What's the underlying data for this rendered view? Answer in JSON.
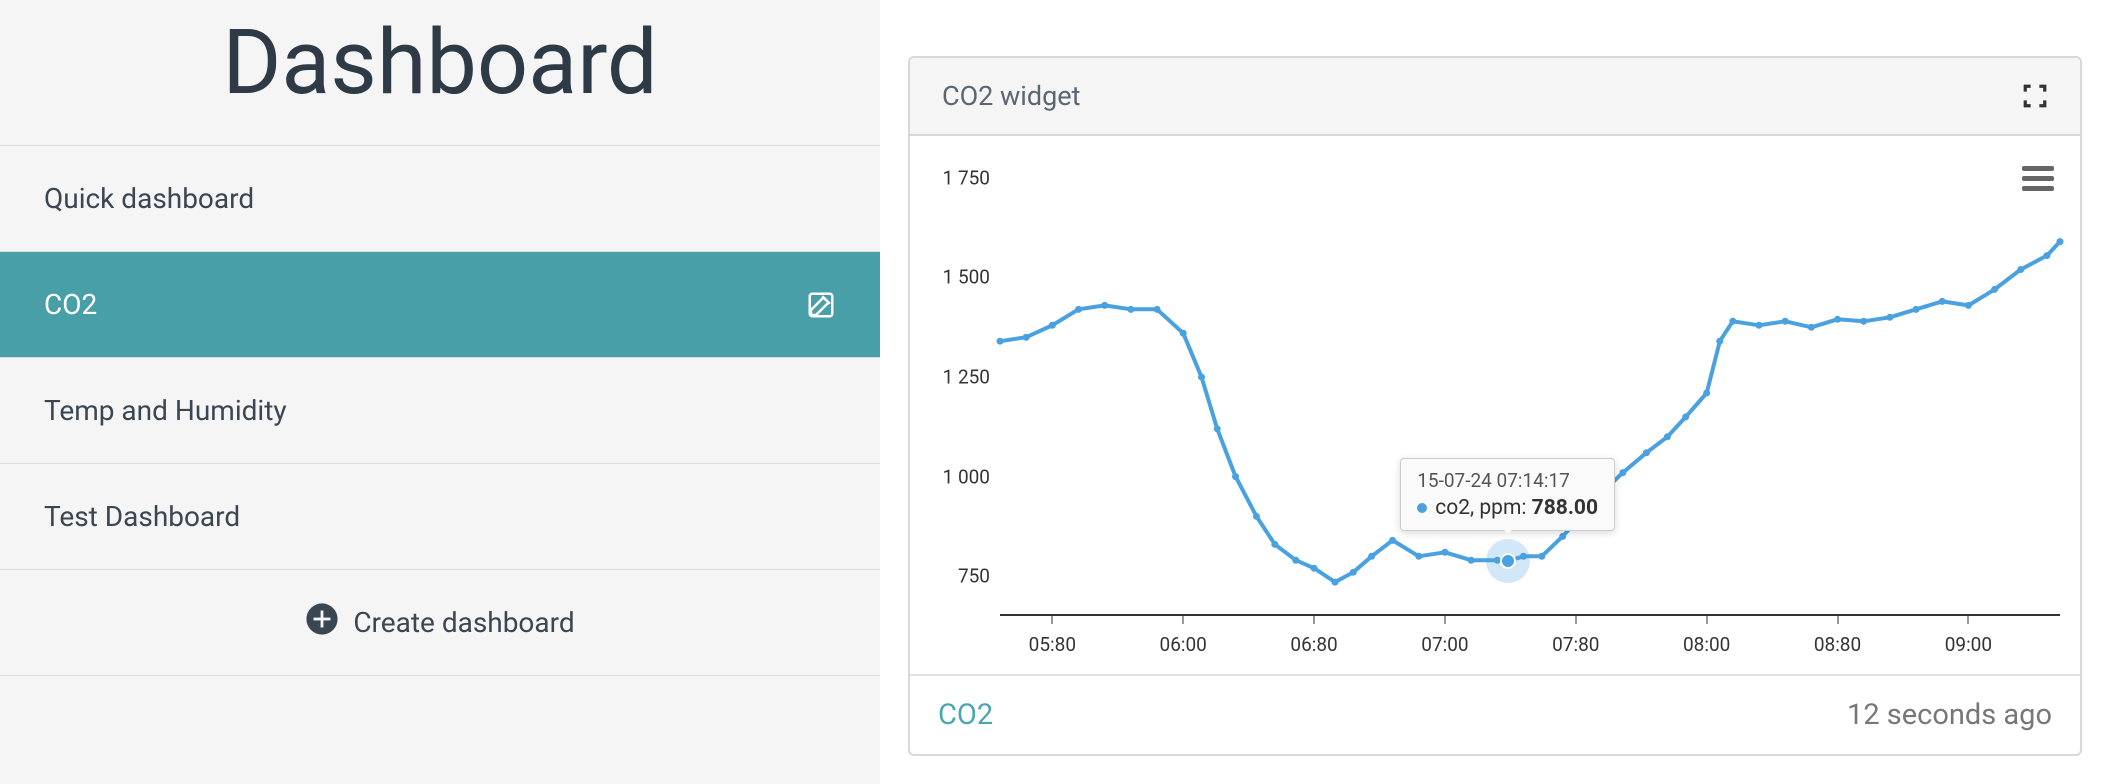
{
  "sidebar": {
    "title": "Dashboard",
    "items": [
      {
        "label": "Quick dashboard",
        "active": false
      },
      {
        "label": "CO2",
        "active": true
      },
      {
        "label": "Temp and Humidity",
        "active": false
      },
      {
        "label": "Test Dashboard",
        "active": false
      }
    ],
    "create_label": "Create dashboard"
  },
  "widget": {
    "title": "CO2 widget",
    "series_link_label": "CO2",
    "last_update": "12 seconds  ago",
    "tooltip": {
      "date": "15-07-24 07:14:17",
      "series_label": "co2, ppm:",
      "value": "788.00"
    }
  },
  "chart_data": {
    "type": "line",
    "title": "",
    "xlabel": "",
    "ylabel": "",
    "ylim": [
      650,
      1800
    ],
    "y_ticks": [
      750,
      1000,
      1250,
      1500,
      1750
    ],
    "y_tick_labels": [
      "750",
      "1 000",
      "1 250",
      "1 500",
      "1 750"
    ],
    "x_ticks": [
      5.5,
      6.0,
      6.5,
      7.0,
      7.5,
      8.0,
      8.5,
      9.0
    ],
    "x_tick_labels": [
      "05:80",
      "06:00",
      "06:80",
      "07:00",
      "07:80",
      "08:00",
      "08:80",
      "09:00"
    ],
    "xlim": [
      5.3,
      9.35
    ],
    "series": [
      {
        "name": "co2, ppm",
        "color": "#4aa1e0",
        "x": [
          5.3,
          5.4,
          5.5,
          5.6,
          5.7,
          5.8,
          5.9,
          6.0,
          6.07,
          6.13,
          6.2,
          6.28,
          6.35,
          6.43,
          6.5,
          6.58,
          6.65,
          6.72,
          6.8,
          6.9,
          7.0,
          7.1,
          7.2,
          7.24,
          7.3,
          7.37,
          7.45,
          7.52,
          7.6,
          7.68,
          7.77,
          7.85,
          7.92,
          8.0,
          8.05,
          8.1,
          8.2,
          8.3,
          8.4,
          8.5,
          8.6,
          8.7,
          8.8,
          8.9,
          9.0,
          9.1,
          9.2,
          9.3,
          9.35
        ],
        "values": [
          1340,
          1350,
          1380,
          1420,
          1430,
          1420,
          1420,
          1360,
          1250,
          1120,
          1000,
          900,
          830,
          790,
          770,
          735,
          760,
          800,
          840,
          800,
          810,
          790,
          790,
          788,
          800,
          800,
          850,
          900,
          960,
          1010,
          1060,
          1100,
          1150,
          1210,
          1340,
          1390,
          1380,
          1390,
          1375,
          1395,
          1390,
          1400,
          1420,
          1440,
          1430,
          1470,
          1520,
          1555,
          1590
        ]
      }
    ],
    "hover": {
      "x": 7.24,
      "y": 788
    }
  }
}
